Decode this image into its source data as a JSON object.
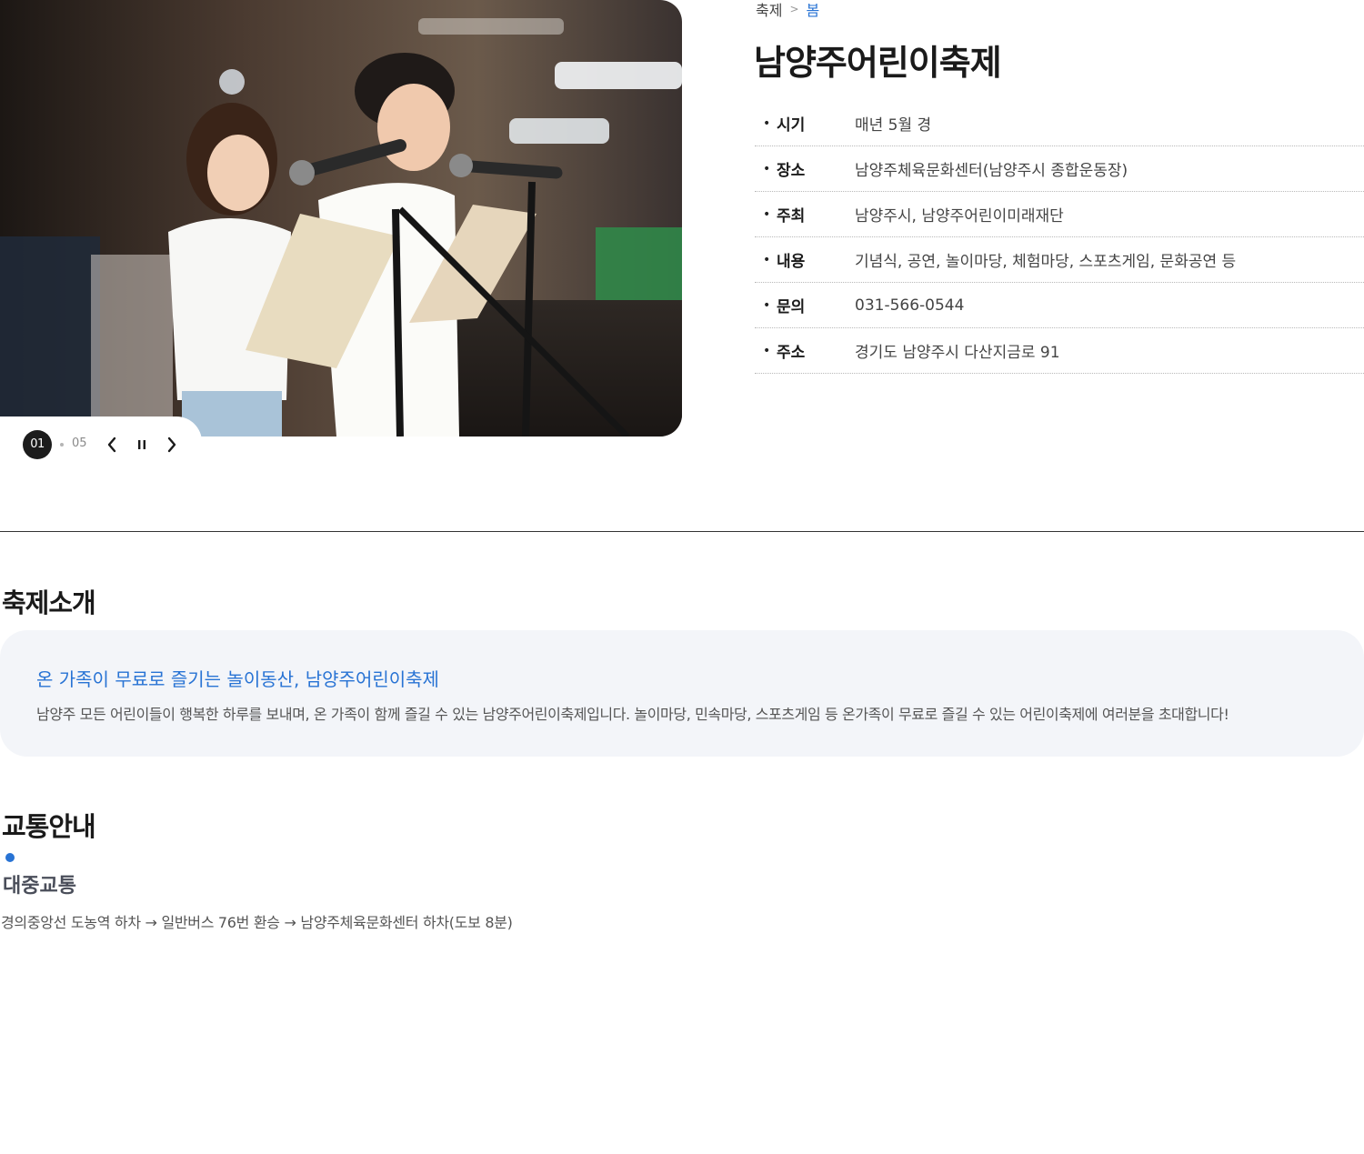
{
  "slider": {
    "current": "01",
    "total": "05",
    "photo_alt": "Children reading at microphones on stage"
  },
  "breadcrumb": {
    "items": [
      "축제",
      "봄"
    ]
  },
  "page": {
    "title": "남양주어린이축제"
  },
  "info": [
    {
      "label": "시기",
      "value": "매년 5월 경"
    },
    {
      "label": "장소",
      "value": "남양주체육문화센터(남양주시 종합운동장)"
    },
    {
      "label": "주최",
      "value": "남양주시, 남양주어린이미래재단"
    },
    {
      "label": "내용",
      "value": "기념식, 공연, 놀이마당, 체험마당, 스포츠게임, 문화공연 등"
    },
    {
      "label": "문의",
      "value": "031-566-0544"
    },
    {
      "label": "주소",
      "value": "경기도 남양주시 다산지금로 91"
    }
  ],
  "intro": {
    "section_title": "축제소개",
    "headline": "온 가족이 무료로 즐기는 놀이동산, 남양주어린이축제",
    "body": "남양주 모든 어린이들이 행복한 하루를 보내며, 온 가족이 함께 즐길 수 있는 남양주어린이축제입니다. 놀이마당, 민속마당, 스포츠게임 등 온가족이 무료로 즐길 수 있는 어린이축제에 여러분을 초대합니다!"
  },
  "transport": {
    "section_title": "교통안내",
    "subheading": "대중교통",
    "description": "경의중앙선 도농역 하차 → 일반버스 76번 환승 → 남양주체육문화센터 하차(도보 8분)"
  },
  "colors": {
    "accent": "#2873d4",
    "intro_bg": "#f3f5f9",
    "title": "#1a1a1a"
  },
  "icons": {
    "prev": "chevron-left-icon",
    "pause": "pause-icon",
    "next": "chevron-right-icon",
    "breadcrumb_sep": "chevron-right-icon"
  }
}
